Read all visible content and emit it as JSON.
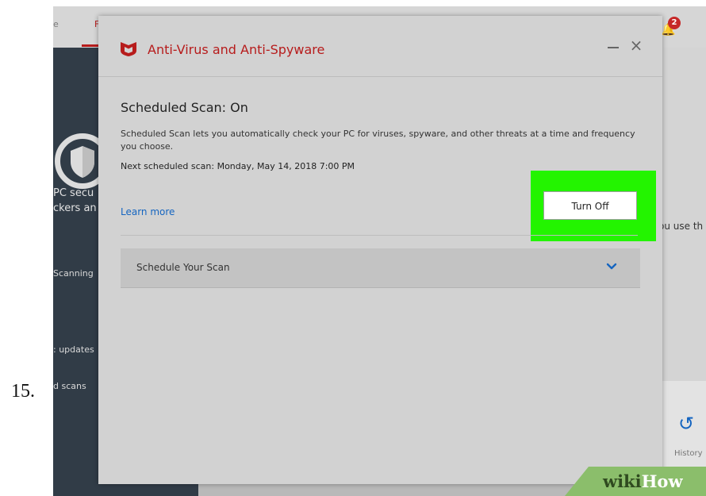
{
  "step_number": "15.",
  "background_app": {
    "tabs_partial": [
      "e",
      "F"
    ],
    "notification_count": "2",
    "sidebar_headline_line1": "PC secu",
    "sidebar_headline_line2": "ckers an",
    "sidebar_items": [
      "Scanning",
      ": updates",
      "d scans"
    ],
    "right_text": "ou use th",
    "history_label": "History"
  },
  "dialog": {
    "title": "Anti-Virus and Anti-Spyware",
    "brand_color": "#b71c1c",
    "scan_title": "Scheduled Scan: On",
    "description": "Scheduled Scan lets you automatically check your PC for viruses, spyware, and other threats at a time and frequency you choose.",
    "next_scan": "Next scheduled scan: Monday, May 14, 2018 7:00 PM",
    "learn_more": "Learn more",
    "turn_off_label": "Turn Off",
    "highlight_color": "#23f400",
    "schedule_section_label": "Schedule Your Scan",
    "close_symbol": "×"
  },
  "watermark": {
    "wiki": "wiki",
    "how": "How"
  }
}
